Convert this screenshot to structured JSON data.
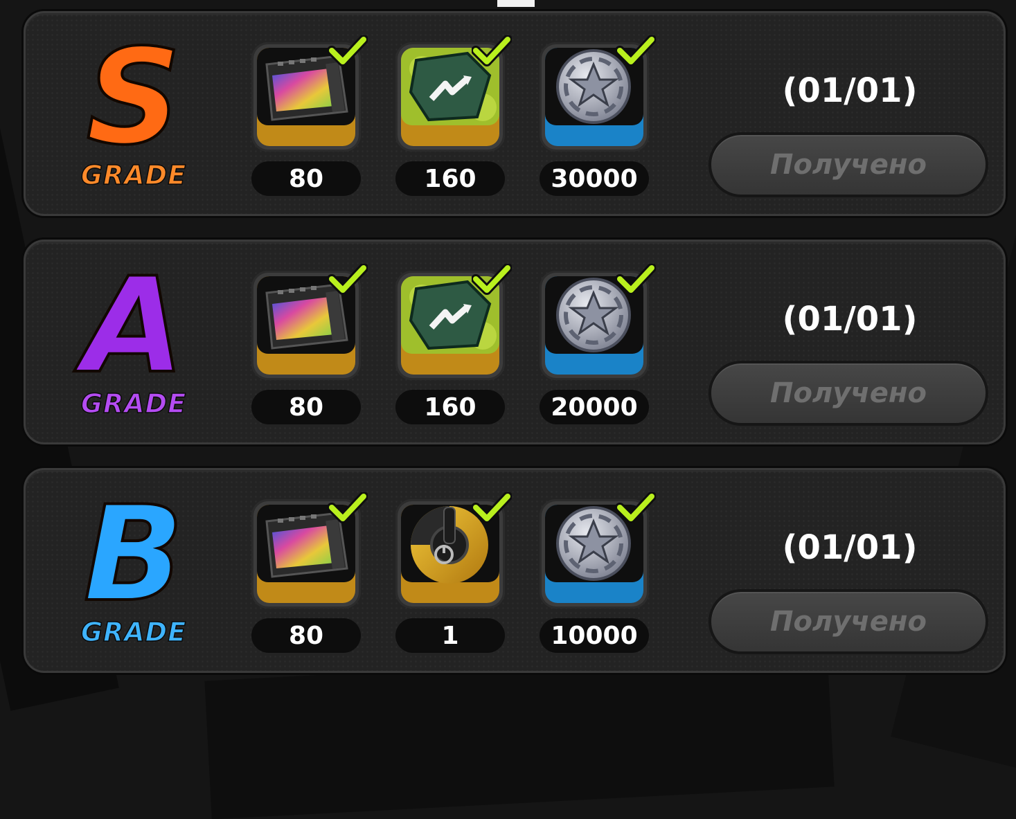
{
  "colors": {
    "grade_s": "#ff6a14",
    "grade_a": "#9c2de8",
    "grade_b": "#2aa6ff",
    "check": "#b9f01e",
    "gold_frame": "#c18a18",
    "blue_frame": "#1a83c8"
  },
  "grades": [
    {
      "letter": "S",
      "word": "GRADE",
      "progress": "(01/01)",
      "button_label": "Получено",
      "rewards": [
        {
          "icon": "film-reel-icon",
          "frame": "gold",
          "amount": "80",
          "claimed": true
        },
        {
          "icon": "green-gem-shard-icon",
          "frame": "gold",
          "amount": "160",
          "claimed": true
        },
        {
          "icon": "silver-star-coin-icon",
          "frame": "blue",
          "amount": "30000",
          "claimed": true
        }
      ]
    },
    {
      "letter": "A",
      "word": "GRADE",
      "progress": "(01/01)",
      "button_label": "Получено",
      "rewards": [
        {
          "icon": "film-reel-icon",
          "frame": "gold",
          "amount": "80",
          "claimed": true
        },
        {
          "icon": "green-gem-shard-icon",
          "frame": "gold",
          "amount": "160",
          "claimed": true
        },
        {
          "icon": "silver-star-coin-icon",
          "frame": "blue",
          "amount": "20000",
          "claimed": true
        }
      ]
    },
    {
      "letter": "B",
      "word": "GRADE",
      "progress": "(01/01)",
      "button_label": "Получено",
      "rewards": [
        {
          "icon": "film-reel-icon",
          "frame": "gold",
          "amount": "80",
          "claimed": true
        },
        {
          "icon": "power-disc-icon",
          "frame": "gold",
          "amount": "1",
          "claimed": true
        },
        {
          "icon": "silver-star-coin-icon",
          "frame": "blue",
          "amount": "10000",
          "claimed": true
        }
      ]
    }
  ]
}
